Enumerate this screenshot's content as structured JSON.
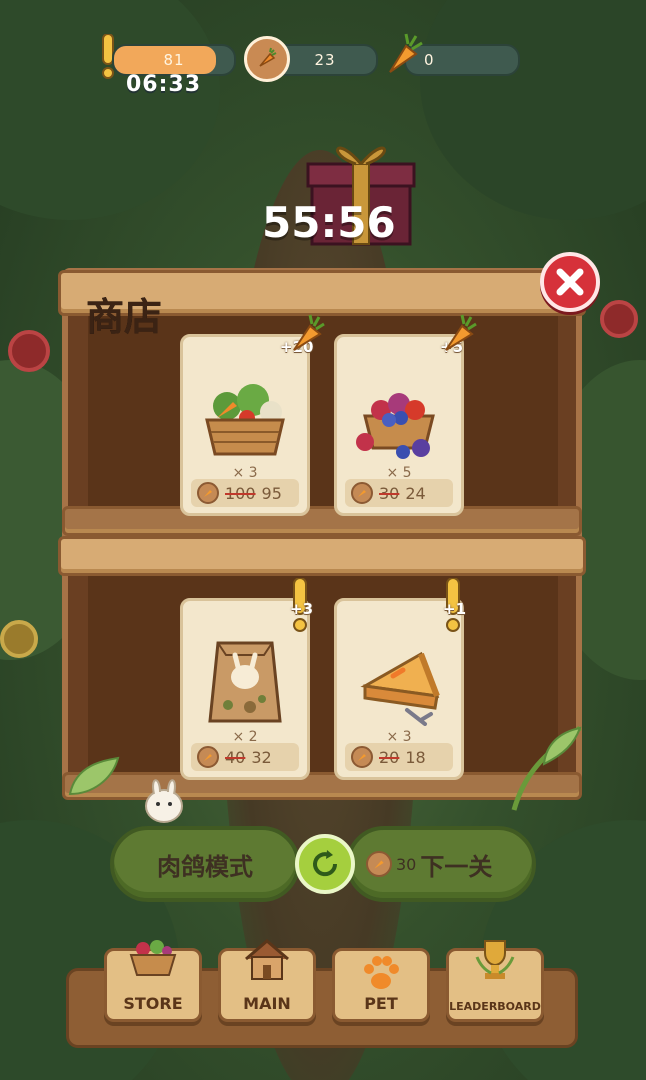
{
  "hud": {
    "energy": "81",
    "energy_fraction": 0.85,
    "carrots": "23",
    "gold_carrots": "0",
    "timer_small": "06:33"
  },
  "event": {
    "countdown": "55:56"
  },
  "shop": {
    "title": "商店",
    "items": [
      {
        "icon": "vegetable-basket",
        "bonus": "+20",
        "quantity": "× 3",
        "old_price": "100",
        "price": "95"
      },
      {
        "icon": "berry-basket",
        "bonus": "+5",
        "quantity": "× 5",
        "old_price": "30",
        "price": "24"
      },
      {
        "icon": "food-bag",
        "bonus": "+3",
        "quantity": "× 2",
        "old_price": "40",
        "price": "32"
      },
      {
        "icon": "pie",
        "bonus": "+1",
        "quantity": "× 3",
        "old_price": "20",
        "price": "18"
      }
    ]
  },
  "actions": {
    "rogue_mode_label": "肉鸽模式",
    "next_level_cost": "30",
    "next_level_label": "下一关"
  },
  "nav": {
    "store": "STORE",
    "main": "MAIN",
    "pet": "PET",
    "leaderboard": "LEADERBOARD"
  },
  "colors": {
    "energy_fill": "#f2a85a",
    "close_red": "#d6313a",
    "button_green": "#5e7a32",
    "refresh_green": "#a5cf3e",
    "wood": "#d7ab74"
  }
}
